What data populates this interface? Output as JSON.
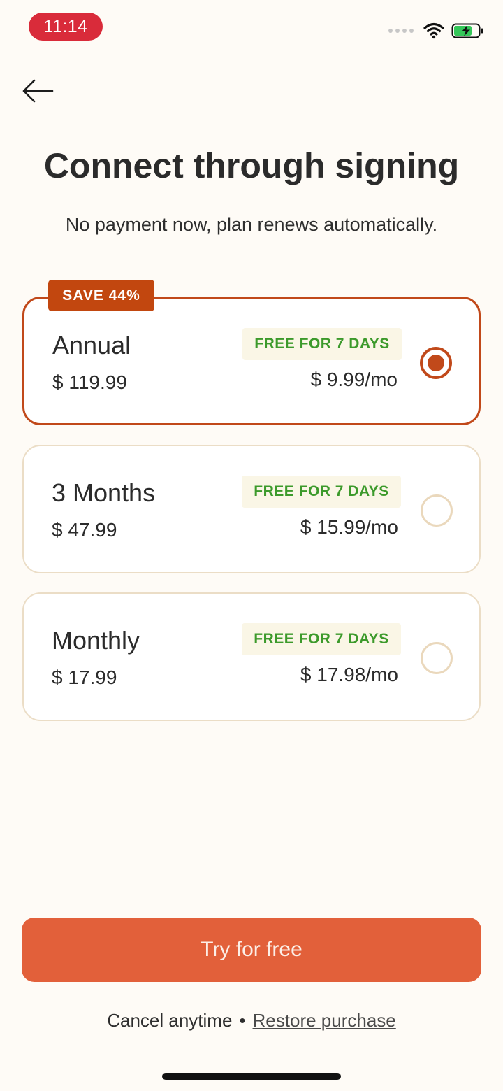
{
  "status_bar": {
    "time": "11:14"
  },
  "header": {
    "title": "Connect through signing",
    "subtitle": "No payment now, plan renews automatically."
  },
  "plans": [
    {
      "name": "Annual",
      "total": "$ 119.99",
      "trial": "FREE FOR 7 DAYS",
      "per_month": "$ 9.99/mo",
      "badge": "SAVE 44%",
      "selected": true
    },
    {
      "name": "3 Months",
      "total": "$ 47.99",
      "trial": "FREE FOR 7 DAYS",
      "per_month": "$ 15.99/mo",
      "selected": false
    },
    {
      "name": "Monthly",
      "total": "$ 17.99",
      "trial": "FREE FOR 7 DAYS",
      "per_month": "$ 17.98/mo",
      "selected": false
    }
  ],
  "cta": {
    "label": "Try for free"
  },
  "footer": {
    "cancel_text": "Cancel anytime",
    "separator": "•",
    "restore_label": "Restore purchase"
  },
  "colors": {
    "accent": "#C1491A",
    "cta": "#E2603A",
    "trial_text": "#3C9A2B",
    "background": "#FEFBF6"
  },
  "icons": {
    "back": "arrow-left-icon",
    "wifi": "wifi-icon",
    "battery": "battery-charging-icon"
  }
}
